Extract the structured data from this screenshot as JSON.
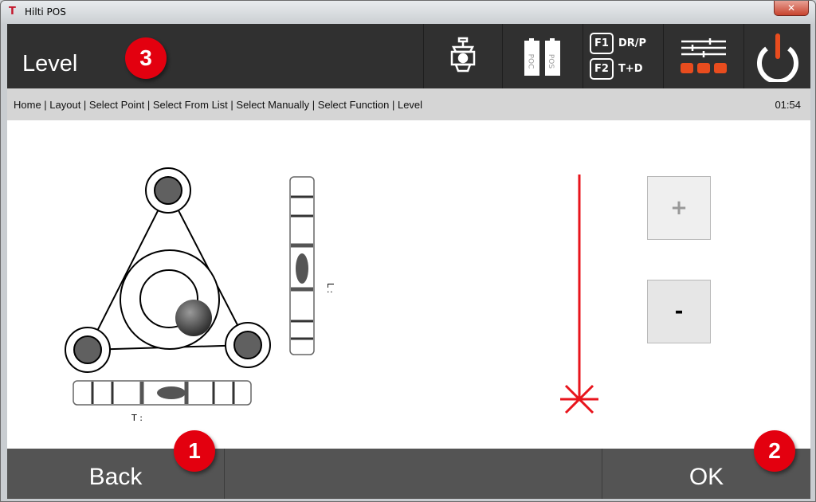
{
  "window": {
    "title": "Hilti POS",
    "close": "✕"
  },
  "header": {
    "title": "Level",
    "f1": "F1",
    "f1_label": "DR/P",
    "f2": "F2",
    "f2_label": "T+D",
    "battery1": "POC",
    "battery2": "POS"
  },
  "breadcrumb": {
    "path": "Home | Layout | Select Point | Select From List | Select Manually | Select Function | Level",
    "time": "01:54"
  },
  "level": {
    "t_label": "T :",
    "l_label": "L :"
  },
  "controls": {
    "plus": "+",
    "minus": "-"
  },
  "footer": {
    "back": "Back",
    "ok": "OK"
  },
  "badges": [
    "1",
    "2",
    "3"
  ],
  "colors": {
    "accent": "#e3000f",
    "orange": "#e84c1e",
    "header": "#303030",
    "footer": "#545454"
  }
}
